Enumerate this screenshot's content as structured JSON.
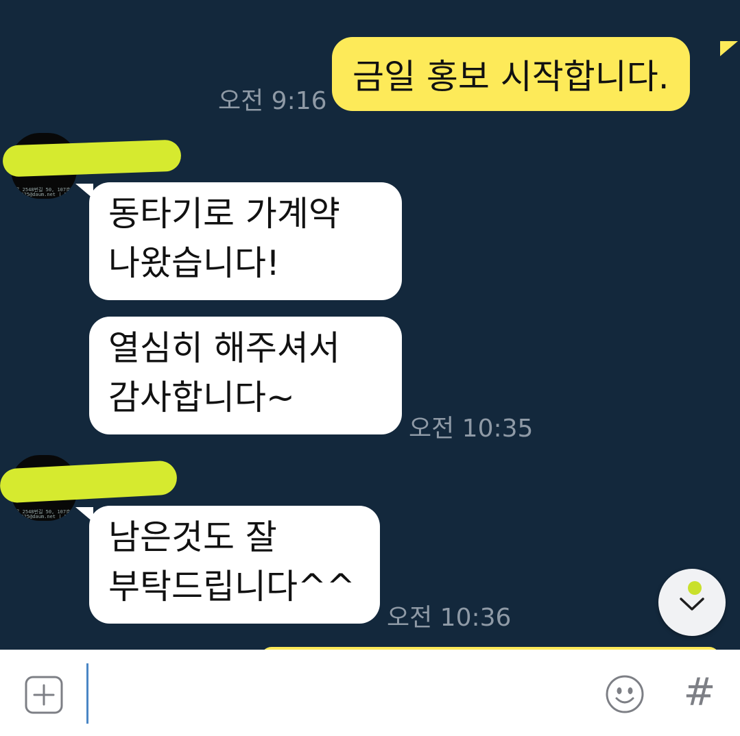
{
  "messages": {
    "m1": {
      "lines": [
        "금일 홍보 시작합니다."
      ],
      "time": "오전 9:16"
    },
    "m2": {
      "lines": [
        "동타기로 가계약",
        "나왔습니다!"
      ]
    },
    "m3": {
      "lines": [
        "열심히 해주셔서",
        "감사합니다~"
      ],
      "time": "오전 10:35"
    },
    "m4": {
      "lines": [
        "남은것도 잘",
        "부탁드립니다^^"
      ],
      "time": "오전 10:36"
    }
  },
  "avatar_caption": [
    "로 2548번길 50, 107호",
    "m0425@daum.net | Rap // ayster"
  ],
  "icons": {
    "attach": "plus-square-icon",
    "emoji": "smiley-icon",
    "hashtag": "hashtag-icon",
    "scroll": "chevron-down-icon"
  },
  "input": {
    "hashtag_glyph": "#",
    "value": ""
  },
  "colors": {
    "chat_background": "#13283c",
    "my_bubble": "#fdea59",
    "their_bubble": "#ffffff",
    "timestamp": "#8f9aa6",
    "redaction_marker": "#d6ea2f",
    "caret": "#4a86c5"
  }
}
